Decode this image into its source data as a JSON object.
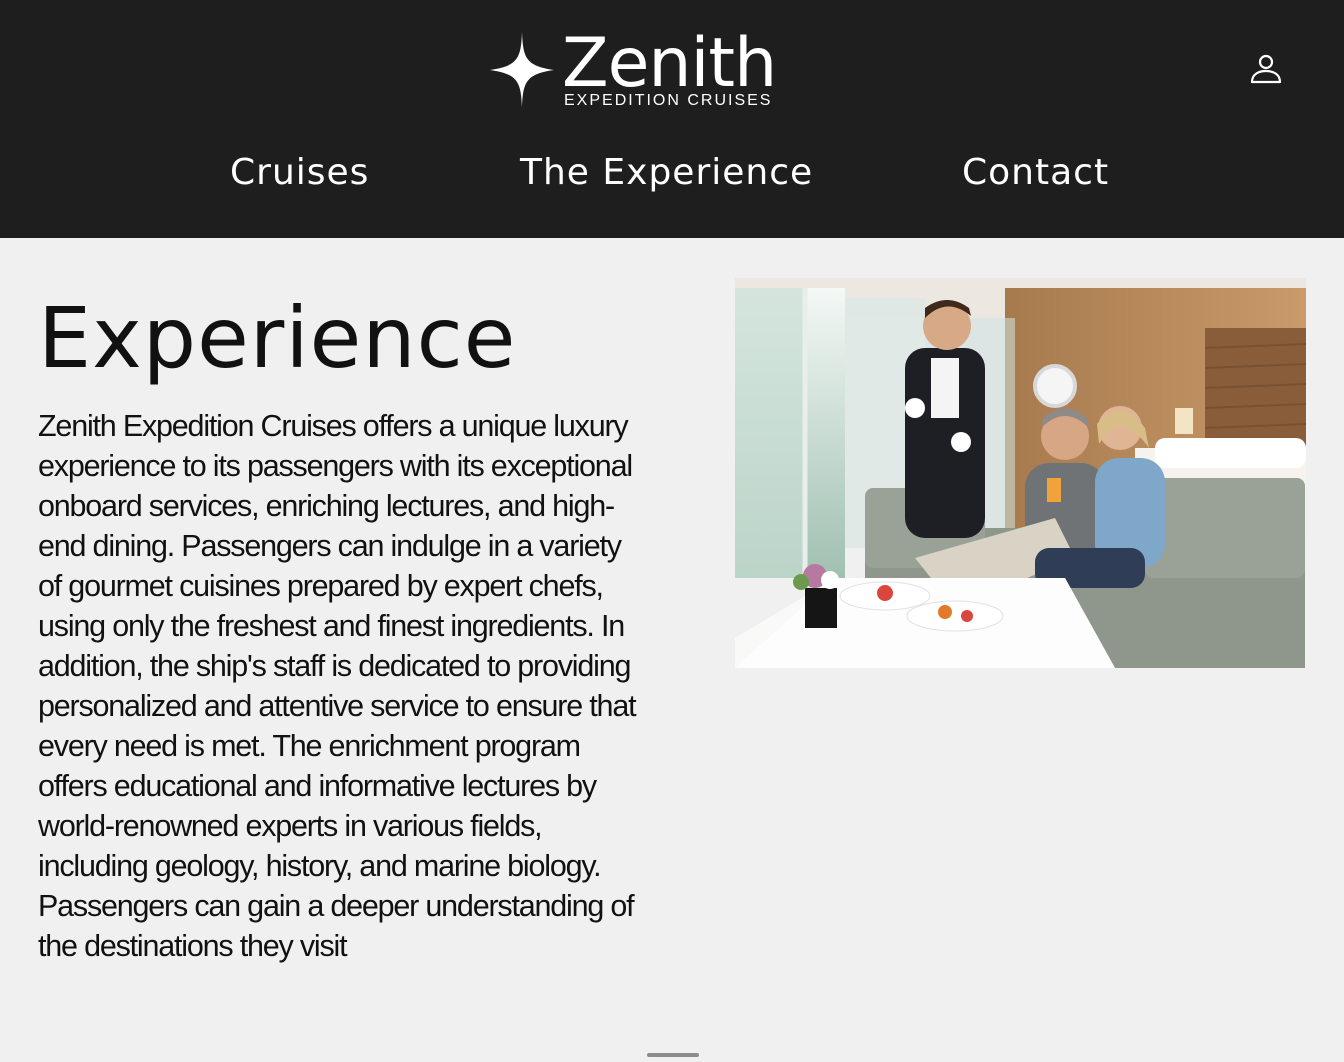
{
  "header": {
    "logo": {
      "name": "Zenith",
      "tagline": "EXPEDITION CRUISES"
    },
    "account_icon": "user-icon",
    "nav": [
      {
        "label": "Cruises"
      },
      {
        "label": "The Experience"
      },
      {
        "label": "Contact"
      }
    ]
  },
  "main": {
    "title": "Experience",
    "body": "Zenith Expedition Cruises offers a unique luxury experience to its passengers with its exceptional onboard services, enriching lectures, and high-end dining. Passengers can indulge in a variety of gourmet cuisines prepared by expert chefs, using only the freshest and finest ingredients. In addition, the ship's staff is dedicated to providing personalized and attentive service to ensure that every need is met. The enrichment program offers educational and informative lectures by world-renowned experts in various fields, including geology, history, and marine biology. Passengers can gain a deeper understanding of the destinations they visit"
  },
  "colors": {
    "header_bg": "#1e1e1e",
    "page_bg": "#f0f0f0",
    "text": "#111111"
  }
}
